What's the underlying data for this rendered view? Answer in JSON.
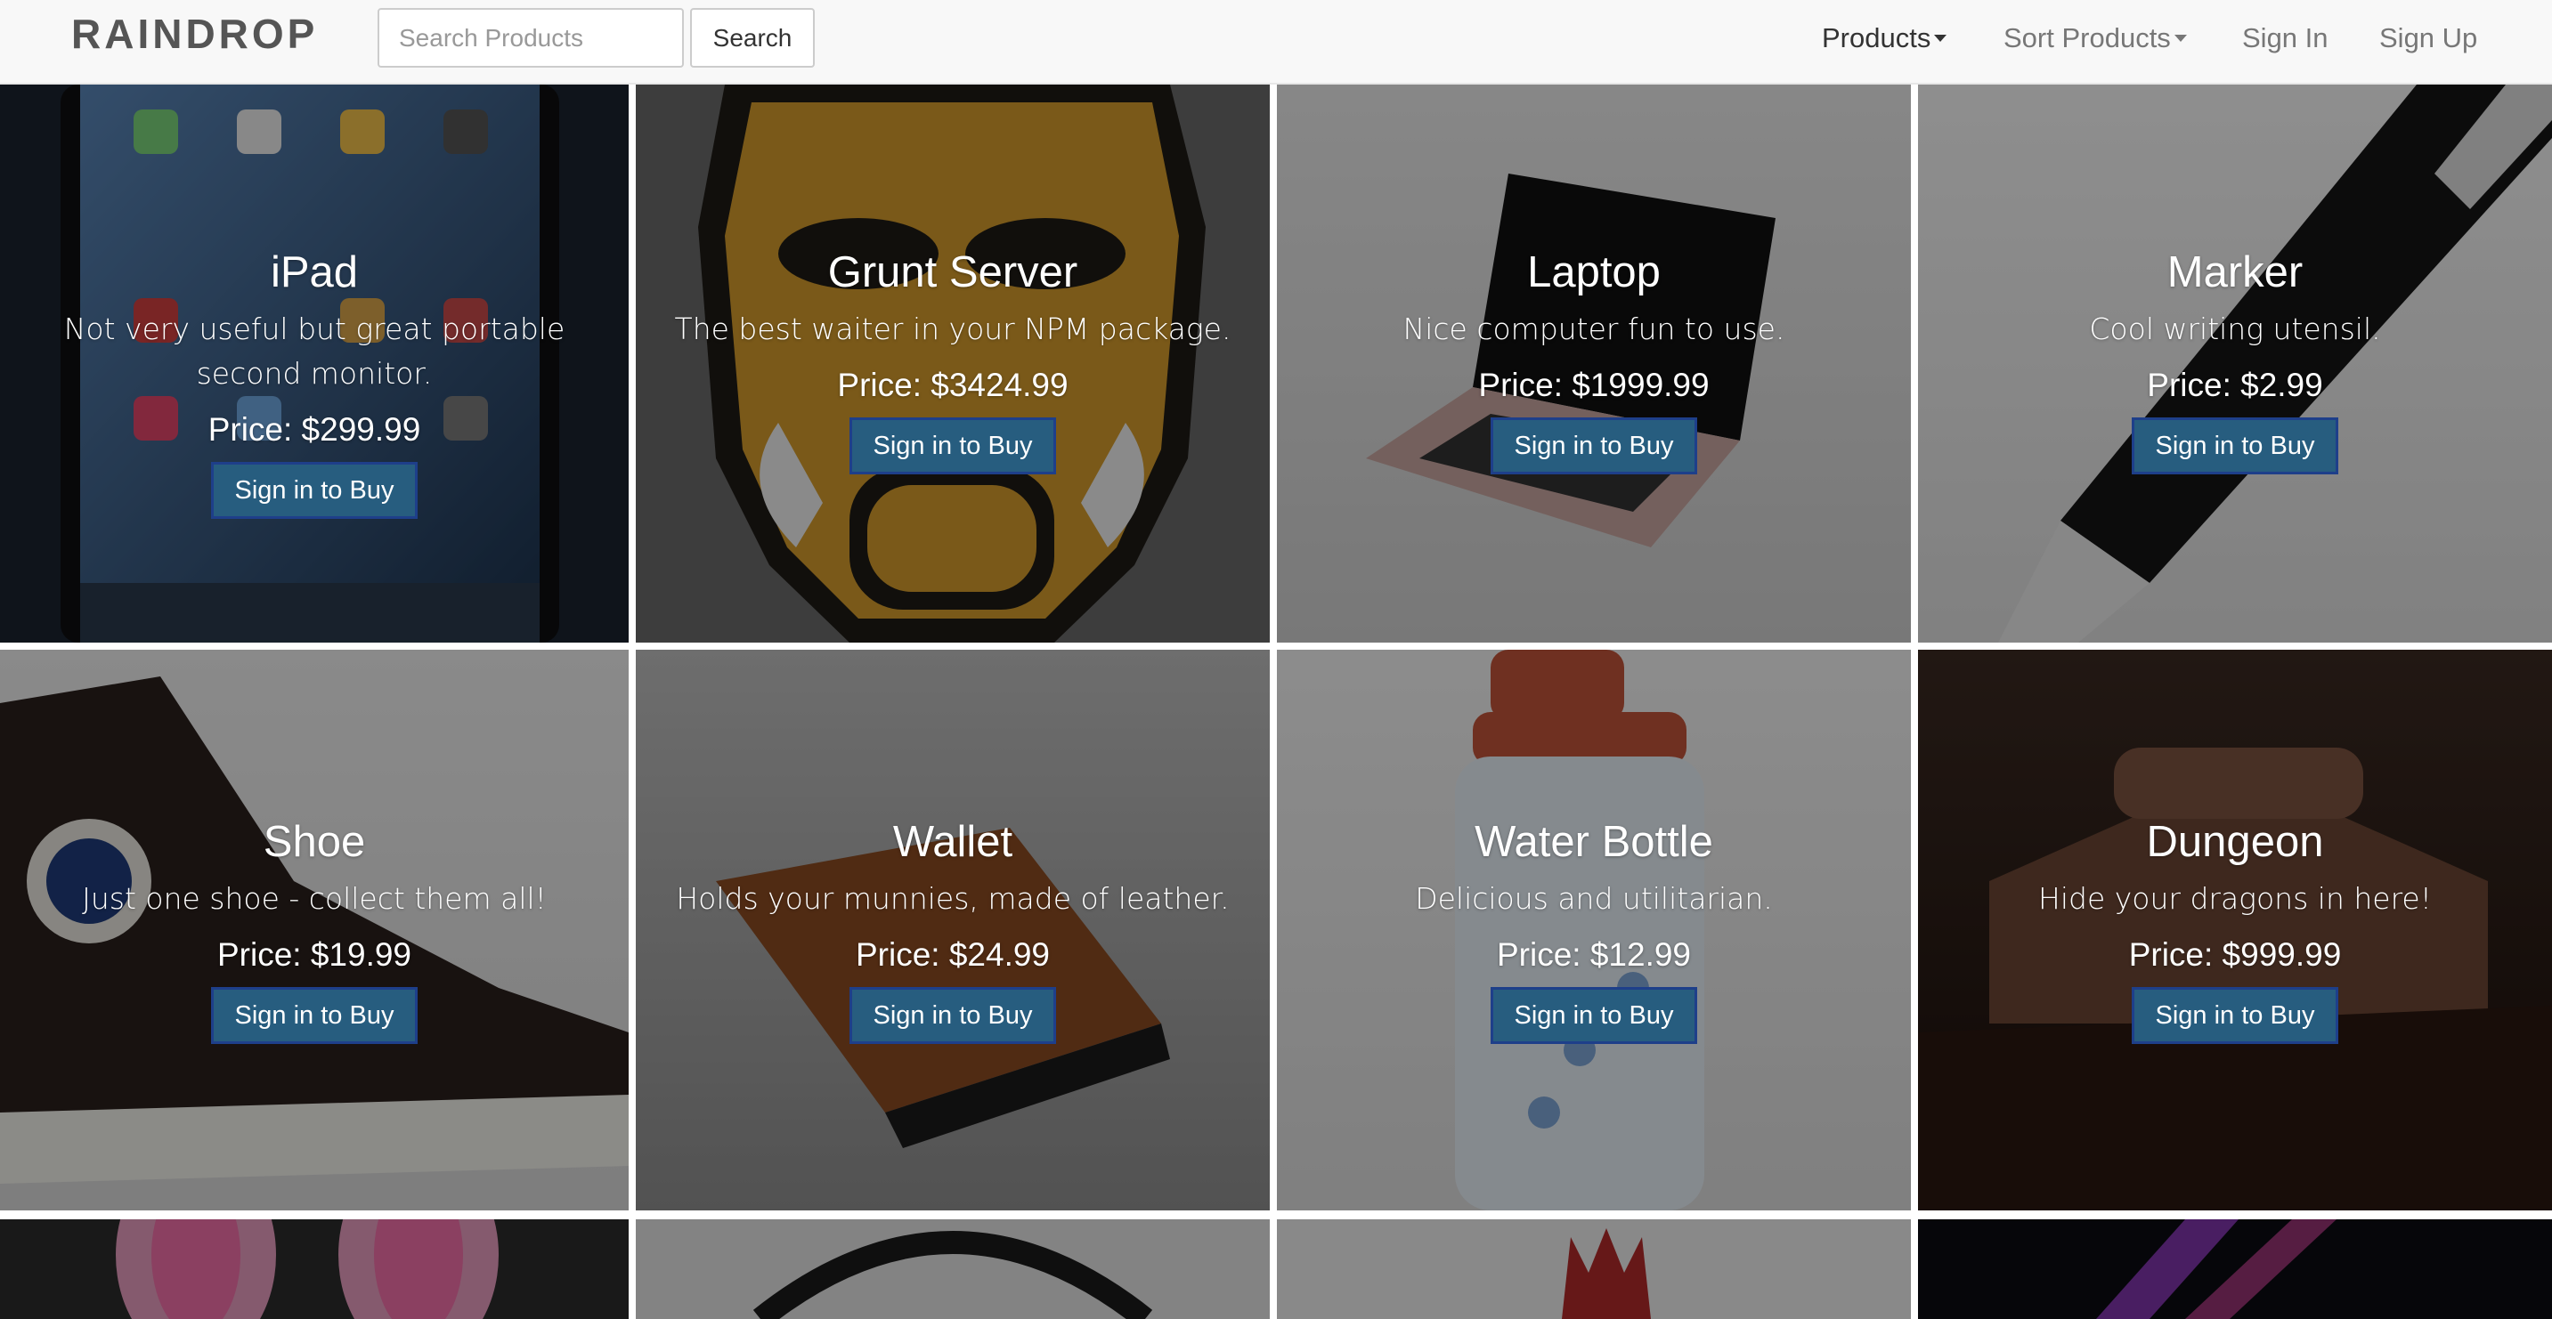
{
  "nav": {
    "brand": "RAINDROP",
    "search_placeholder": "Search Products",
    "search_button": "Search",
    "products": "Products",
    "sort_products": "Sort Products",
    "sign_in": "Sign In",
    "sign_up": "Sign Up"
  },
  "buy_label": "Sign in to Buy",
  "products": [
    {
      "name": "iPad",
      "description": "Not very useful but great portable second monitor.",
      "price": "Price: $299.99"
    },
    {
      "name": "Grunt Server",
      "description": "The best waiter in your NPM package.",
      "price": "Price: $3424.99"
    },
    {
      "name": "Laptop",
      "description": "Nice computer fun to use.",
      "price": "Price: $1999.99"
    },
    {
      "name": "Marker",
      "description": "Cool writing utensil.",
      "price": "Price: $2.99"
    },
    {
      "name": "Shoe",
      "description": "Just one shoe - collect them all!",
      "price": "Price: $19.99"
    },
    {
      "name": "Wallet",
      "description": "Holds your munnies, made of leather.",
      "price": "Price: $24.99"
    },
    {
      "name": "Water Bottle",
      "description": "Delicious and utilitarian.",
      "price": "Price: $12.99"
    },
    {
      "name": "Dungeon",
      "description": "Hide your dragons in here!",
      "price": "Price: $999.99"
    }
  ],
  "colors": {
    "buy_button_bg": "#275d7f",
    "buy_button_border": "#1e3f8a",
    "navbar_bg": "#f8f8f8"
  }
}
